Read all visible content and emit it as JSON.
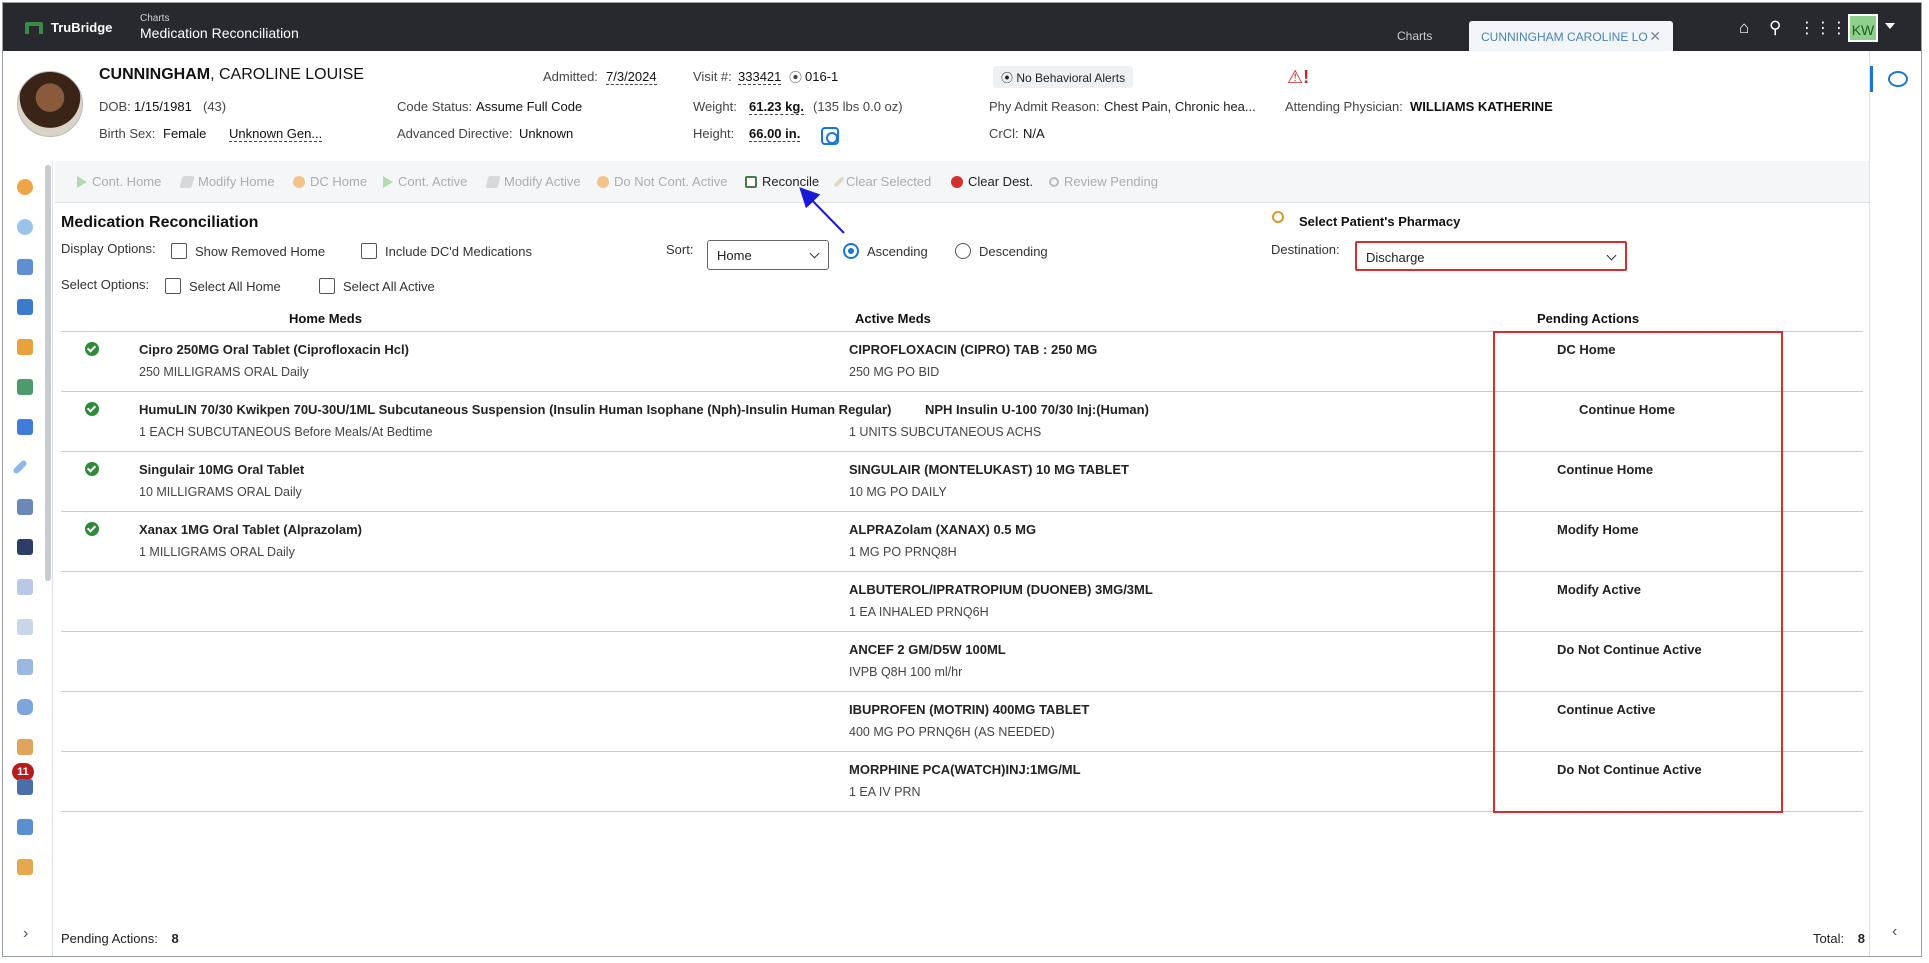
{
  "topbar": {
    "brand": "TruBridge",
    "breadcrumb_parent": "Charts",
    "breadcrumb_current": "Medication Reconciliation",
    "charts_tab": "Charts",
    "patient_tab": "CUNNINGHAM CAROLINE LO",
    "user_initials": "KW",
    "accent_color": "#8fd08c"
  },
  "patient": {
    "last_name": "CUNNINGHAM",
    "first_name": ", CAROLINE LOUISE",
    "dob_label": "DOB:",
    "dob": "1/15/1981",
    "age": "(43)",
    "sex_label": "Birth Sex:",
    "sex": "Female",
    "gender": "Unknown Gen...",
    "admitted_label": "Admitted:",
    "admitted": "7/3/2024",
    "visit_label": "Visit #:",
    "visit": "333421",
    "room": "016-1",
    "code_status_label": "Code Status:",
    "code_status": "Assume Full Code",
    "adv_directive_label": "Advanced Directive:",
    "adv_directive": "Unknown",
    "weight_label": "Weight:",
    "weight": "61.23 kg.",
    "weight_alt": "(135 lbs 0.0 oz)",
    "height_label": "Height:",
    "height": "66.00 in.",
    "behavioral": "No Behavioral Alerts",
    "phy_admit_label": "Phy Admit Reason:",
    "phy_admit": "Chest Pain, Chronic hea...",
    "crcl_label": "CrCl:",
    "crcl": "N/A",
    "attending_label": "Attending Physician:",
    "attending": "WILLIAMS KATHERINE"
  },
  "toolbar": {
    "cont_home": "Cont. Home",
    "modify_home": "Modify Home",
    "dc_home": "DC Home",
    "cont_active": "Cont. Active",
    "modify_active": "Modify Active",
    "do_not_cont_active": "Do Not Cont. Active",
    "reconcile": "Reconcile",
    "clear_selected": "Clear Selected",
    "clear_dest": "Clear Dest.",
    "review_pending": "Review Pending"
  },
  "main": {
    "title": "Medication Reconciliation",
    "display_options_label": "Display Options:",
    "show_removed_home": "Show Removed Home",
    "include_dc": "Include DC'd Medications",
    "select_options_label": "Select Options:",
    "select_all_home": "Select All Home",
    "select_all_active": "Select All Active",
    "sort_label": "Sort:",
    "sort_value": "Home",
    "ascending": "Ascending",
    "descending": "Descending",
    "pharmacy_label": "Select Patient's Pharmacy",
    "destination_label": "Destination:",
    "destination_value": "Discharge",
    "col_home": "Home Meds",
    "col_active": "Active Meds",
    "col_pending": "Pending Actions"
  },
  "rows": [
    {
      "home_name": "Cipro 250MG Oral Tablet (Ciprofloxacin Hcl)",
      "home_sig": "250 MILLIGRAMS ORAL Daily",
      "active_name": "CIPROFLOXACIN (CIPRO) TAB : 250 MG",
      "active_sig": "250 MG PO BID",
      "action": "DC Home"
    },
    {
      "home_name": "HumuLIN 70/30 Kwikpen 70U-30U/1ML Subcutaneous Suspension (Insulin Human Isophane (Nph)-Insulin Human Regular)",
      "home_sig": "1 EACH SUBCUTANEOUS Before Meals/At Bedtime",
      "active_name": "NPH Insulin U-100 70/30 Inj:(Human)",
      "active_sig": "1 UNITS SUBCUTANEOUS ACHS",
      "action": "Continue Home"
    },
    {
      "home_name": "Singulair 10MG Oral Tablet",
      "home_sig": "10 MILLIGRAMS ORAL Daily",
      "active_name": "SINGULAIR (MONTELUKAST) 10 MG TABLET",
      "active_sig": "10 MG PO DAILY",
      "action": "Continue Home"
    },
    {
      "home_name": "Xanax 1MG Oral Tablet (Alprazolam)",
      "home_sig": "1 MILLIGRAMS ORAL Daily",
      "active_name": "ALPRAZolam (XANAX) 0.5 MG",
      "active_sig": "1 MG PO PRNQ8H",
      "action": "Modify Home"
    },
    {
      "home_name": "",
      "home_sig": "",
      "active_name": "ALBUTEROL/IPRATROPIUM (DUONEB) 3MG/3ML",
      "active_sig": "1 EA INHALED PRNQ6H",
      "action": "Modify Active"
    },
    {
      "home_name": "",
      "home_sig": "",
      "active_name": "ANCEF 2 GM/D5W 100ML",
      "active_sig": "IVPB Q8H 100 ml/hr",
      "action": "Do Not Continue Active"
    },
    {
      "home_name": "",
      "home_sig": "",
      "active_name": "IBUPROFEN (MOTRIN) 400MG TABLET",
      "active_sig": "400 MG PO PRNQ6H (AS NEEDED)",
      "action": "Continue Active"
    },
    {
      "home_name": "",
      "home_sig": "",
      "active_name": "MORPHINE PCA(WATCH)INJ:1MG/ML",
      "active_sig": "1 EA IV PRN",
      "action": "Do Not Continue Active"
    }
  ],
  "footer": {
    "pending_label": "Pending Actions:",
    "pending_count": "8",
    "total_label": "Total:",
    "total_count": "8"
  },
  "sidebar": {
    "badge_count": "11"
  }
}
